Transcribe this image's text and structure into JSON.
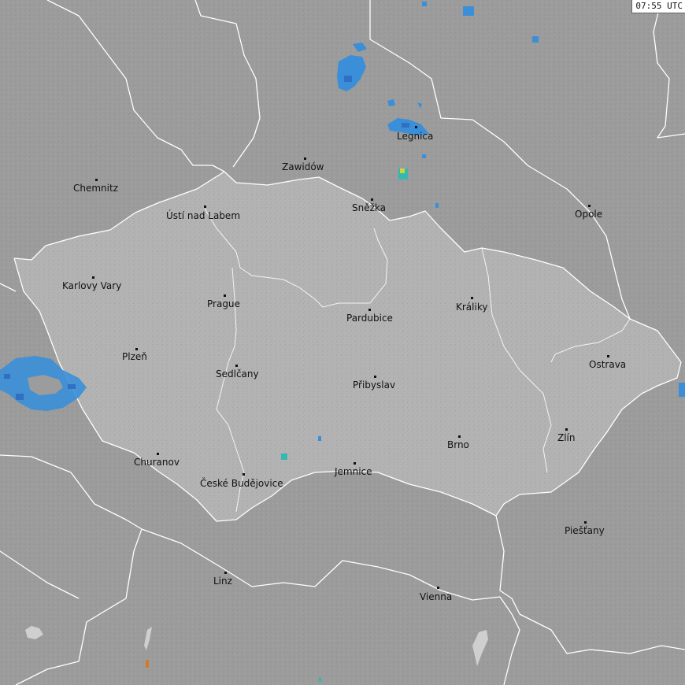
{
  "timestamp": "07:55 UTC",
  "colors": {
    "background": "#9c9c9c",
    "czech_fill": "#b3b3b3",
    "border": "#ffffff",
    "precip_light": "#3a8fd8",
    "precip_medium": "#2f6fc4",
    "precip_strong": "#35b8b0",
    "precip_heavy": "#c8d83a"
  },
  "cities": [
    {
      "id": "chemnitz",
      "name": "Chemnitz"
    },
    {
      "id": "usti",
      "name": "Ústí nad Labem"
    },
    {
      "id": "zawidow",
      "name": "Zawidów"
    },
    {
      "id": "legnica",
      "name": "Legnica"
    },
    {
      "id": "snezka",
      "name": "Sněžka"
    },
    {
      "id": "opole",
      "name": "Opole"
    },
    {
      "id": "karlovy-vary",
      "name": "Karlovy Vary"
    },
    {
      "id": "prague",
      "name": "Prague"
    },
    {
      "id": "pardubice",
      "name": "Pardubice"
    },
    {
      "id": "kraliky",
      "name": "Králiky"
    },
    {
      "id": "plzen",
      "name": "Plzeň"
    },
    {
      "id": "sedlcany",
      "name": "Sedlčany"
    },
    {
      "id": "pribyslav",
      "name": "Přibyslav"
    },
    {
      "id": "ostrava",
      "name": "Ostrava"
    },
    {
      "id": "zlin",
      "name": "Zlín"
    },
    {
      "id": "brno",
      "name": "Brno"
    },
    {
      "id": "churanov",
      "name": "Churanov"
    },
    {
      "id": "ceske-budejovice",
      "name": "České Budějovice"
    },
    {
      "id": "jemnice",
      "name": "Jemnice"
    },
    {
      "id": "piestany",
      "name": "Piešťany"
    },
    {
      "id": "linz",
      "name": "Linz"
    },
    {
      "id": "vienna",
      "name": "Vienna"
    }
  ]
}
